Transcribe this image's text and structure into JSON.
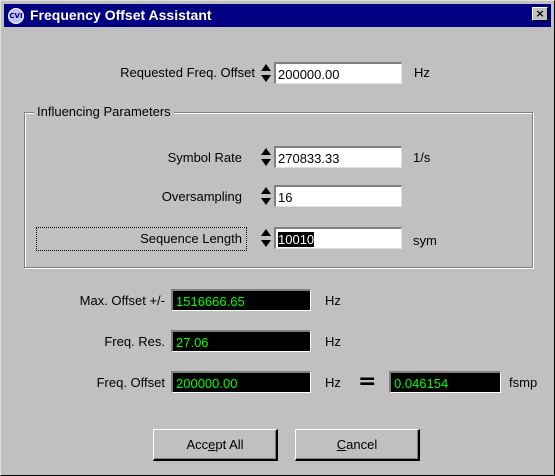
{
  "window": {
    "title": "Frequency Offset Assistant",
    "icon_text": "CVI",
    "close_glyph": "×"
  },
  "requested_offset": {
    "label": "Requested Freq. Offset",
    "value": "200000.00",
    "unit": "Hz"
  },
  "influencing": {
    "title": "Influencing Parameters",
    "symbol_rate": {
      "label": "Symbol  Rate",
      "value": "270833.33",
      "unit": "1/s"
    },
    "oversampling": {
      "label": "Oversampling",
      "value": "16"
    },
    "sequence_length": {
      "label": "Sequence Length",
      "value": "10010",
      "unit": "sym"
    }
  },
  "results": {
    "max_offset": {
      "label": "Max. Offset +/-",
      "value": "1516666.65",
      "unit": "Hz"
    },
    "freq_res": {
      "label": "Freq. Res.",
      "value": "27.06",
      "unit": "Hz"
    },
    "freq_offset": {
      "label": "Freq. Offset",
      "value": "200000.00",
      "unit": "Hz",
      "equals": "=",
      "normalized_value": "0.046154",
      "normalized_unit": "fsmp"
    }
  },
  "buttons": {
    "accept_all": {
      "pre": "Acc",
      "hotkey": "e",
      "post": "pt All"
    },
    "cancel": {
      "pre": "",
      "hotkey": "C",
      "post": "ancel"
    }
  },
  "colors": {
    "title_bar": "#000080",
    "dialog_bg": "#c0c0c0",
    "display_bg": "#000000",
    "display_text": "#00ff00"
  }
}
